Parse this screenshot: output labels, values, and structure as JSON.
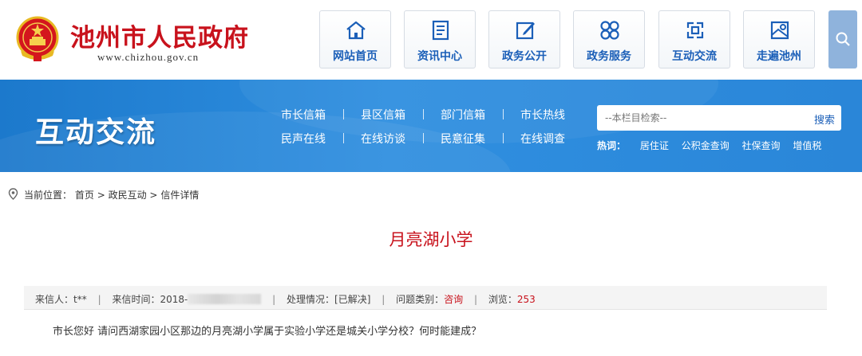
{
  "header": {
    "site_title": "池州市人民政府",
    "site_url": "www.chizhou.gov.cn",
    "nav": [
      {
        "label": "网站首页",
        "icon": "home-icon"
      },
      {
        "label": "资讯中心",
        "icon": "news-icon"
      },
      {
        "label": "政务公开",
        "icon": "edit-icon"
      },
      {
        "label": "政务服务",
        "icon": "grid-icon"
      },
      {
        "label": "互动交流",
        "icon": "interact-icon"
      },
      {
        "label": "走遍池州",
        "icon": "map-icon"
      }
    ],
    "search_icon": "search-icon",
    "accent_color": "#c8121c",
    "nav_text_color": "#1b5fb8"
  },
  "banner": {
    "title": "互动交流",
    "menu_row1": [
      "市长信箱",
      "县区信箱",
      "部门信箱",
      "市长热线"
    ],
    "menu_row2": [
      "民声在线",
      "在线访谈",
      "民意征集",
      "在线调查"
    ],
    "search_placeholder": "--本栏目检索--",
    "search_button": "搜索",
    "hot_label": "热词：",
    "hot_words": [
      "居住证",
      "公积金查询",
      "社保查询",
      "增值税"
    ],
    "bg_color": "#2a86d8"
  },
  "breadcrumb": {
    "prefix": "当前位置：",
    "items": [
      "首页",
      "政民互动",
      "信件详情"
    ],
    "separator": ">"
  },
  "article": {
    "title": "月亮湖小学",
    "info": {
      "sender_label": "来信人：",
      "sender": "t**",
      "time_label": "来信时间：",
      "time": "2018-",
      "status_label": "处理情况：",
      "status": "[已解决]",
      "category_label": "问题类别：",
      "category": "咨询",
      "views_label": "浏览：",
      "views": "253"
    },
    "content": "市长您好 请问西湖家园小区那边的月亮湖小学属于实验小学还是城关小学分校？何时能建成？"
  }
}
